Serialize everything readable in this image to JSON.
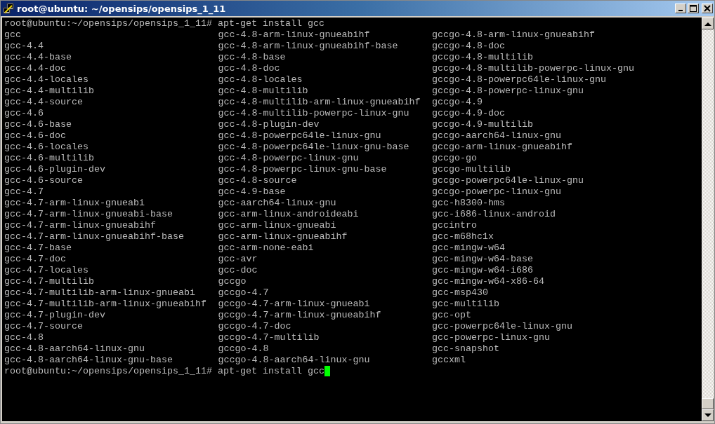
{
  "window": {
    "title": "root@ubuntu: ~/opensips/opensips_1_11"
  },
  "terminal": {
    "command_line": {
      "prompt": "root@ubuntu:~/opensips/opensips_1_11#",
      "command": "apt-get install gcc"
    },
    "completions": [
      [
        "gcc",
        "gcc-4.4",
        "gcc-4.4-base",
        "gcc-4.4-doc",
        "gcc-4.4-locales",
        "gcc-4.4-multilib",
        "gcc-4.4-source",
        "gcc-4.6",
        "gcc-4.6-base",
        "gcc-4.6-doc",
        "gcc-4.6-locales",
        "gcc-4.6-multilib",
        "gcc-4.6-plugin-dev",
        "gcc-4.6-source",
        "gcc-4.7",
        "gcc-4.7-arm-linux-gnueabi",
        "gcc-4.7-arm-linux-gnueabi-base",
        "gcc-4.7-arm-linux-gnueabihf",
        "gcc-4.7-arm-linux-gnueabihf-base",
        "gcc-4.7-base",
        "gcc-4.7-doc",
        "gcc-4.7-locales",
        "gcc-4.7-multilib",
        "gcc-4.7-multilib-arm-linux-gnueabi",
        "gcc-4.7-multilib-arm-linux-gnueabihf",
        "gcc-4.7-plugin-dev",
        "gcc-4.7-source",
        "gcc-4.8",
        "gcc-4.8-aarch64-linux-gnu",
        "gcc-4.8-aarch64-linux-gnu-base"
      ],
      [
        "gcc-4.8-arm-linux-gnueabihf",
        "gcc-4.8-arm-linux-gnueabihf-base",
        "gcc-4.8-base",
        "gcc-4.8-doc",
        "gcc-4.8-locales",
        "gcc-4.8-multilib",
        "gcc-4.8-multilib-arm-linux-gnueabihf",
        "gcc-4.8-multilib-powerpc-linux-gnu",
        "gcc-4.8-plugin-dev",
        "gcc-4.8-powerpc64le-linux-gnu",
        "gcc-4.8-powerpc64le-linux-gnu-base",
        "gcc-4.8-powerpc-linux-gnu",
        "gcc-4.8-powerpc-linux-gnu-base",
        "gcc-4.8-source",
        "gcc-4.9-base",
        "gcc-aarch64-linux-gnu",
        "gcc-arm-linux-androideabi",
        "gcc-arm-linux-gnueabi",
        "gcc-arm-linux-gnueabihf",
        "gcc-arm-none-eabi",
        "gcc-avr",
        "gcc-doc",
        "gccgo",
        "gccgo-4.7",
        "gccgo-4.7-arm-linux-gnueabi",
        "gccgo-4.7-arm-linux-gnueabihf",
        "gccgo-4.7-doc",
        "gccgo-4.7-multilib",
        "gccgo-4.8",
        "gccgo-4.8-aarch64-linux-gnu"
      ],
      [
        "gccgo-4.8-arm-linux-gnueabihf",
        "gccgo-4.8-doc",
        "gccgo-4.8-multilib",
        "gccgo-4.8-multilib-powerpc-linux-gnu",
        "gccgo-4.8-powerpc64le-linux-gnu",
        "gccgo-4.8-powerpc-linux-gnu",
        "gccgo-4.9",
        "gccgo-4.9-doc",
        "gccgo-4.9-multilib",
        "gccgo-aarch64-linux-gnu",
        "gccgo-arm-linux-gnueabihf",
        "gccgo-go",
        "gccgo-multilib",
        "gccgo-powerpc64le-linux-gnu",
        "gccgo-powerpc-linux-gnu",
        "gcc-h8300-hms",
        "gcc-i686-linux-android",
        "gccintro",
        "gcc-m68hc1x",
        "gcc-mingw-w64",
        "gcc-mingw-w64-base",
        "gcc-mingw-w64-i686",
        "gcc-mingw-w64-x86-64",
        "gcc-msp430",
        "gcc-multilib",
        "gcc-opt",
        "gcc-powerpc64le-linux-gnu",
        "gcc-powerpc-linux-gnu",
        "gcc-snapshot",
        "gccxml"
      ]
    ],
    "input_line": {
      "prompt": "root@ubuntu:~/opensips/opensips_1_11#",
      "command": "apt-get install gcc"
    }
  }
}
